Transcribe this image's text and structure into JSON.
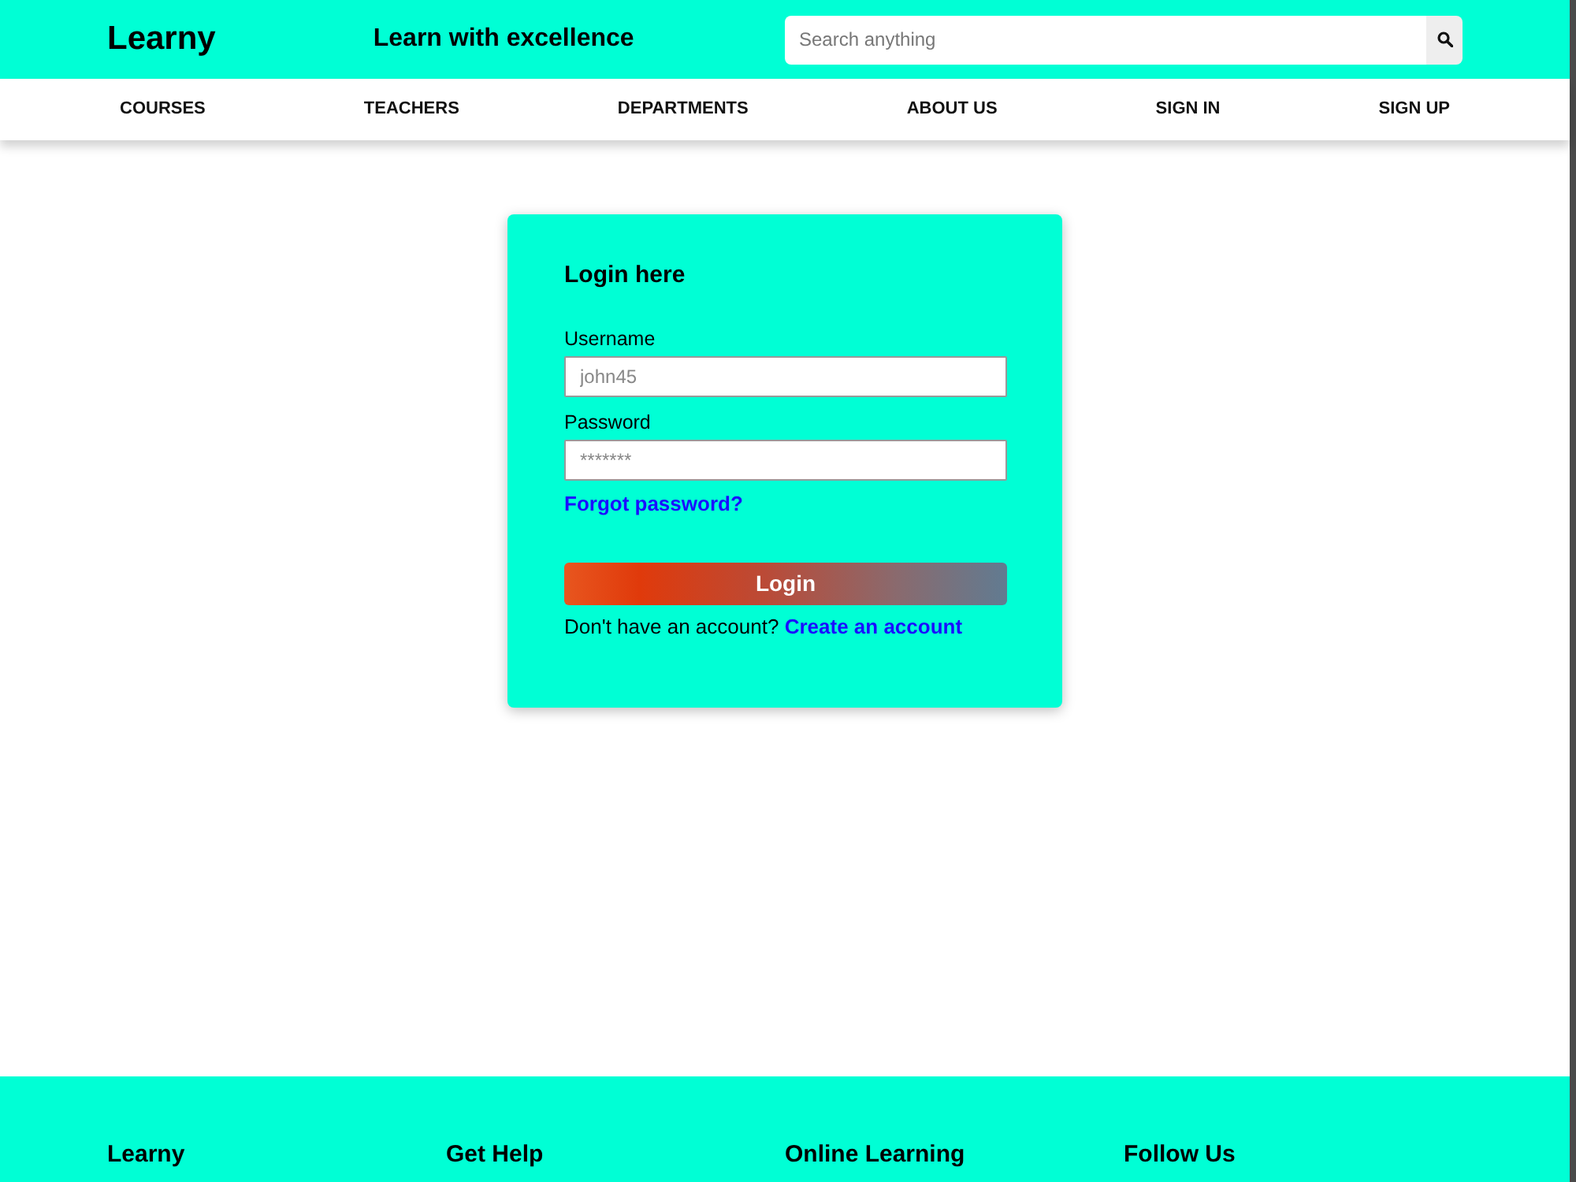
{
  "header": {
    "logo": "Learny",
    "tagline": "Learn with excellence",
    "search": {
      "placeholder": "Search anything"
    }
  },
  "nav": {
    "items": [
      {
        "label": "COURSES"
      },
      {
        "label": "TEACHERS"
      },
      {
        "label": "DEPARTMENTS"
      },
      {
        "label": "ABOUT US"
      },
      {
        "label": "SIGN IN"
      },
      {
        "label": "SIGN UP"
      }
    ]
  },
  "login_card": {
    "title": "Login here",
    "fields": [
      {
        "label": "Username",
        "placeholder": "john45"
      },
      {
        "label": "Password",
        "placeholder": "*******"
      }
    ],
    "forgot_link": "Forgot password?",
    "button": "Login",
    "signup_prompt": "Don't have an account?",
    "signup_link": "Create an account"
  },
  "footer": {
    "columns": [
      {
        "heading": "Learny"
      },
      {
        "heading": "Get Help"
      },
      {
        "heading": "Online Learning"
      },
      {
        "heading": "Follow Us"
      }
    ]
  }
}
